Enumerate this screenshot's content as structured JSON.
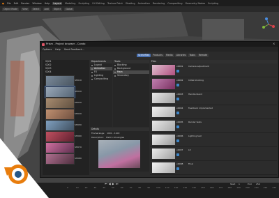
{
  "topbar": {
    "menus": [
      "File",
      "Edit",
      "Render",
      "Window",
      "Help"
    ],
    "workspaces": [
      "Layout",
      "Modeling",
      "Sculpting",
      "UV Editing",
      "Texture Paint",
      "Shading",
      "Animation",
      "Rendering",
      "Compositing",
      "Geometry Nodes",
      "Scripting"
    ],
    "active_workspace": "Layout"
  },
  "toolrow": {
    "mode": "Object Mode",
    "view": "View",
    "select": "Select",
    "add": "Add",
    "object": "Object",
    "transform": "Global"
  },
  "window": {
    "title": "Prism - Project browser - Condo",
    "menu": [
      "Options",
      "Help",
      "Send Feedback..."
    ],
    "tabs": [
      "Scenefiles",
      "Products",
      "Media",
      "Libraries",
      "Tasks",
      "Remote"
    ],
    "active_tab": "Scenefiles"
  },
  "left_panel": {
    "folders": [
      "SQ01",
      "SQ02",
      "SQ03",
      "SQ04"
    ],
    "thumbs": [
      "SH010",
      "SH020",
      "SH030",
      "SH040",
      "SH050",
      "SH060",
      "SH070",
      "SH080"
    ]
  },
  "departments": {
    "header": "Departments",
    "items": [
      "Layout",
      "Animation",
      "FX",
      "Lighting",
      "Compositing"
    ],
    "selected": "Animation"
  },
  "tasks": {
    "header": "Tasks",
    "items": [
      "Blocking",
      "Background",
      "Main",
      "Secondary"
    ],
    "selected": "Main"
  },
  "details": {
    "header": "Details",
    "rows": [
      [
        "Framerange:",
        "1001 - 1100"
      ],
      [
        "Description:",
        "Pistol cut sangles"
      ]
    ]
  },
  "files": {
    "header": "Files",
    "rows": [
      {
        "version": "v0001",
        "description": "Camera adjustment"
      },
      {
        "version": "v0002",
        "description": "Initial blocking"
      },
      {
        "version": "v0003",
        "description": "Handle blend"
      },
      {
        "version": "v0004",
        "description": "Feedback implemented"
      },
      {
        "version": "v0005",
        "description": "Render tests"
      },
      {
        "version": "v0006",
        "description": "Lighting test"
      },
      {
        "version": "v0007",
        "description": "Lit"
      },
      {
        "version": "v0008",
        "description": "Final"
      }
    ]
  },
  "timeline": {
    "ticks": [
      "0",
      "10",
      "20",
      "30",
      "40",
      "50",
      "60",
      "70",
      "80",
      "90",
      "100",
      "110",
      "120",
      "130",
      "140",
      "150",
      "160",
      "170",
      "180",
      "190",
      "200",
      "210",
      "220",
      "230",
      "240"
    ],
    "start_label": "Start",
    "start_value": "1",
    "end_label": "End",
    "end_value": "250"
  },
  "colors": {
    "accent": "#4a72b3",
    "blender_orange": "#e87d0d",
    "blender_blue": "#265787"
  }
}
